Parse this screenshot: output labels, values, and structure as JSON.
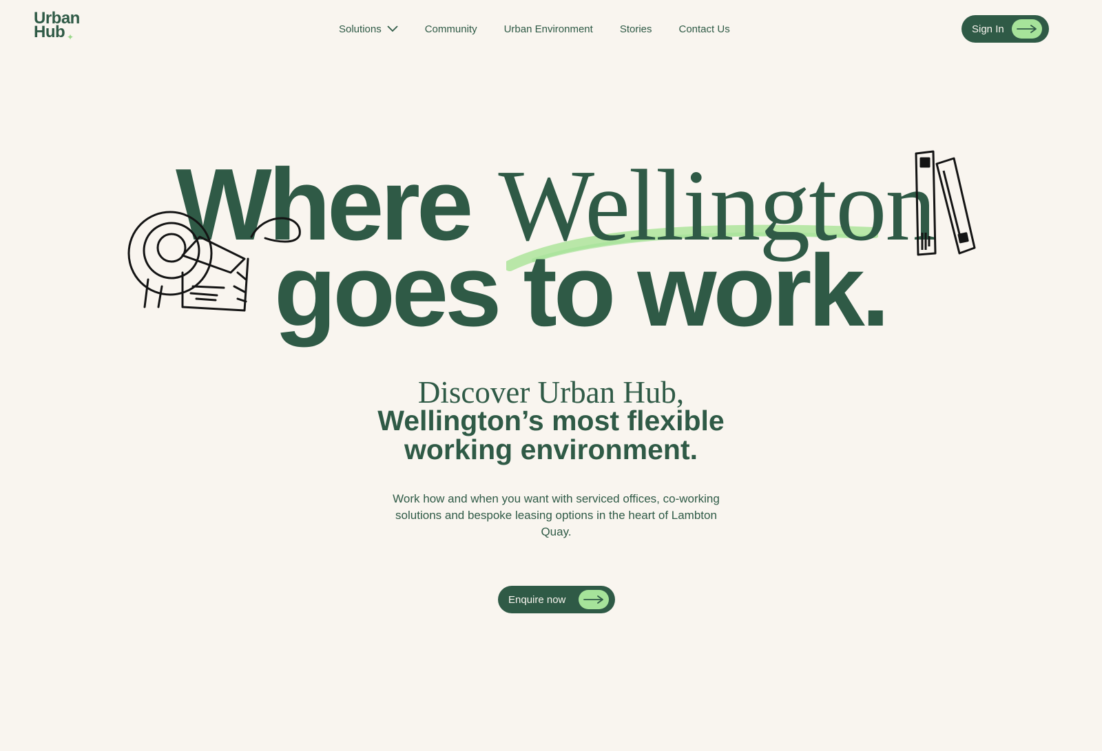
{
  "header": {
    "logo": {
      "line1": "Urban",
      "line2": "Hub"
    },
    "nav": [
      {
        "label": "Solutions",
        "has_dropdown": true
      },
      {
        "label": "Community"
      },
      {
        "label": "Urban Environment"
      },
      {
        "label": "Stories"
      },
      {
        "label": "Contact Us"
      }
    ],
    "sign_in_label": "Sign In"
  },
  "hero": {
    "line1_word1": "Where",
    "line1_word2": "Wellington",
    "line2": "goes to work."
  },
  "subheading": {
    "line1": "Discover Urban Hub,",
    "line2": "Wellington’s most flexible",
    "line3": "working environment."
  },
  "body": "Work how and when you want with serviced offices, co-working solutions and bespoke leasing options in the heart of Lambton Quay.",
  "cta": {
    "label": "Enquire now"
  },
  "icons": [
    "chevron-down-icon",
    "arrow-right-icon",
    "tape-dispenser-illustration",
    "books-illustration"
  ],
  "colors": {
    "primary": "#2f5a46",
    "accent": "#a6e39a",
    "background": "#f9f5ef"
  }
}
